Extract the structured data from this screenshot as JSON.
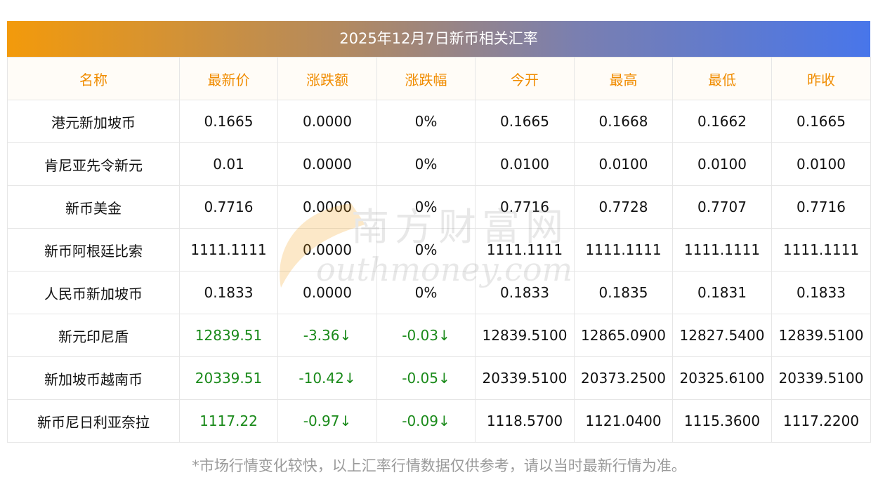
{
  "title": "2025年12月7日新币相关汇率",
  "headers": [
    "名称",
    "最新价",
    "涨跌额",
    "涨跌幅",
    "今开",
    "最高",
    "最低",
    "昨收"
  ],
  "rows": [
    {
      "name": "港元新加坡币",
      "latest": "0.1665",
      "change": "0.0000",
      "pct": "0%",
      "open": "0.1665",
      "high": "0.1668",
      "low": "0.1662",
      "prev": "0.1665",
      "trend": "flat"
    },
    {
      "name": "肯尼亚先令新元",
      "latest": "0.01",
      "change": "0.0000",
      "pct": "0%",
      "open": "0.0100",
      "high": "0.0100",
      "low": "0.0100",
      "prev": "0.0100",
      "trend": "flat"
    },
    {
      "name": "新币美金",
      "latest": "0.7716",
      "change": "0.0000",
      "pct": "0%",
      "open": "0.7716",
      "high": "0.7728",
      "low": "0.7707",
      "prev": "0.7716",
      "trend": "flat"
    },
    {
      "name": "新币阿根廷比索",
      "latest": "1111.1111",
      "change": "0.0000",
      "pct": "0%",
      "open": "1111.1111",
      "high": "1111.1111",
      "low": "1111.1111",
      "prev": "1111.1111",
      "trend": "flat"
    },
    {
      "name": "人民币新加坡币",
      "latest": "0.1833",
      "change": "0.0000",
      "pct": "0%",
      "open": "0.1833",
      "high": "0.1835",
      "low": "0.1831",
      "prev": "0.1833",
      "trend": "flat"
    },
    {
      "name": "新元印尼盾",
      "latest": "12839.51",
      "change": "-3.36↓",
      "pct": "-0.03↓",
      "open": "12839.5100",
      "high": "12865.0900",
      "low": "12827.5400",
      "prev": "12839.5100",
      "trend": "down"
    },
    {
      "name": "新加坡币越南币",
      "latest": "20339.51",
      "change": "-10.42↓",
      "pct": "-0.05↓",
      "open": "20339.5100",
      "high": "20373.2500",
      "low": "20325.6100",
      "prev": "20339.5100",
      "trend": "down"
    },
    {
      "name": "新币尼日利亚奈拉",
      "latest": "1117.22",
      "change": "-0.97↓",
      "pct": "-0.09↓",
      "open": "1118.5700",
      "high": "1121.0400",
      "low": "1115.3600",
      "prev": "1117.2200",
      "trend": "down"
    }
  ],
  "watermark": {
    "cn": "南方财富网",
    "en": "outhmoney.com"
  },
  "note": "*市场行情变化较快，以上汇率行情数据仅供参考，请以当时最新行情为准。",
  "colors": {
    "header_text": "#f08c00",
    "down": "#1a8a1a",
    "gradient_start": "#f39a0b",
    "gradient_end": "#4876ea"
  }
}
